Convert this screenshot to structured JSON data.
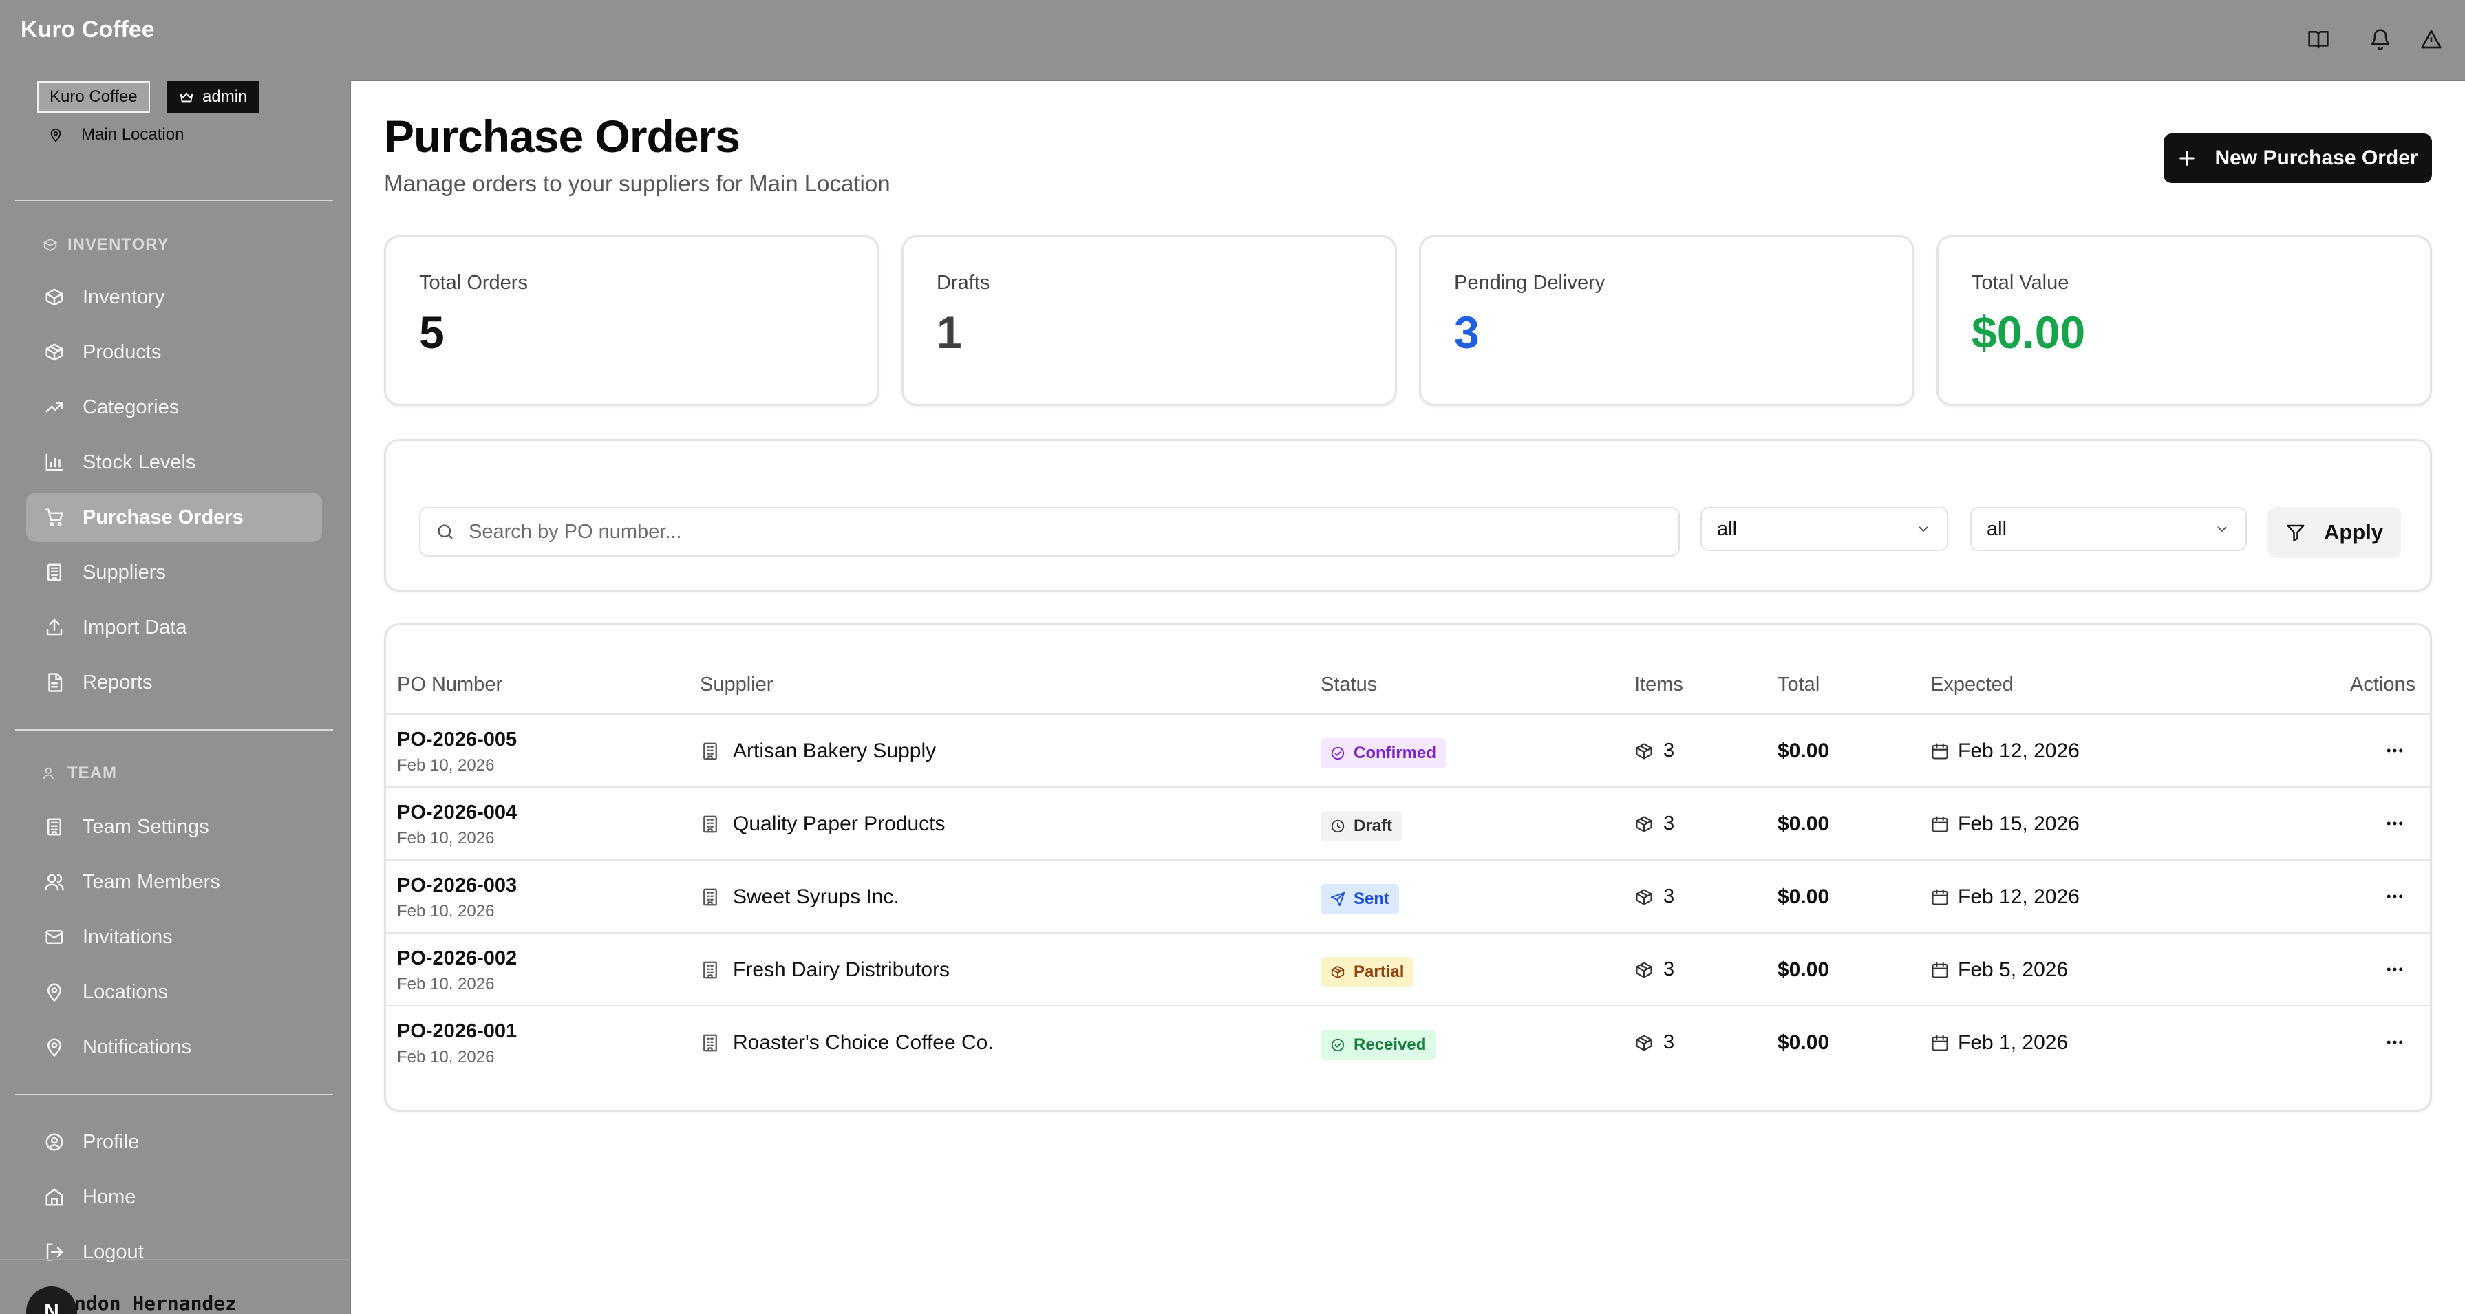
{
  "app": {
    "name": "Kuro Coffee"
  },
  "sidebar": {
    "org_badge": "Kuro Coffee",
    "role_badge": "admin",
    "location": "Main Location",
    "inventory_title": "INVENTORY",
    "inventory_items": [
      {
        "label": "Inventory",
        "icon": "box-icon"
      },
      {
        "label": "Products",
        "icon": "package-icon"
      },
      {
        "label": "Categories",
        "icon": "trending-up-icon"
      },
      {
        "label": "Stock Levels",
        "icon": "bar-chart-icon"
      },
      {
        "label": "Purchase Orders",
        "icon": "cart-icon",
        "active": true
      },
      {
        "label": "Suppliers",
        "icon": "building-icon"
      },
      {
        "label": "Import Data",
        "icon": "upload-icon"
      },
      {
        "label": "Reports",
        "icon": "file-icon"
      }
    ],
    "team_title": "TEAM",
    "team_items": [
      {
        "label": "Team Settings",
        "icon": "building-icon"
      },
      {
        "label": "Team Members",
        "icon": "users-icon"
      },
      {
        "label": "Invitations",
        "icon": "mail-icon"
      },
      {
        "label": "Locations",
        "icon": "map-pin-icon"
      },
      {
        "label": "Notifications",
        "icon": "map-pin-icon"
      }
    ],
    "account_items": [
      {
        "label": "Profile",
        "icon": "user-circle-icon"
      },
      {
        "label": "Home",
        "icon": "home-icon"
      },
      {
        "label": "Logout",
        "icon": "logout-icon"
      }
    ],
    "user": {
      "avatar_initial": "N",
      "name": "ndon Hernandez"
    }
  },
  "topbar": {
    "icons": [
      "book-icon",
      "bell-icon",
      "alert-triangle-icon"
    ]
  },
  "header": {
    "title": "Purchase Orders",
    "subtitle": "Manage orders to your suppliers for Main Location",
    "new_button": "New Purchase Order"
  },
  "stats": [
    {
      "label": "Total Orders",
      "value": "5",
      "color": "#111111"
    },
    {
      "label": "Drafts",
      "value": "1",
      "color": "#3f3f3f"
    },
    {
      "label": "Pending Delivery",
      "value": "3",
      "color": "#1f5fe0"
    },
    {
      "label": "Total Value",
      "value": "$0.00",
      "color": "#16a34a"
    }
  ],
  "filters": {
    "search_placeholder": "Search by PO number...",
    "status_select": "all",
    "supplier_select": "all",
    "apply_label": "Apply"
  },
  "table": {
    "columns": [
      "PO Number",
      "Supplier",
      "Status",
      "Items",
      "Total",
      "Expected",
      "Actions"
    ],
    "rows": [
      {
        "po": "PO-2026-005",
        "date": "Feb 10, 2026",
        "supplier": "Artisan Bakery Supply",
        "status": "Confirmed",
        "status_icon": "check-circle-icon",
        "status_bg": "#f3e8ff",
        "status_fg": "#7e22ce",
        "items": "3",
        "total": "$0.00",
        "expected": "Feb 12, 2026"
      },
      {
        "po": "PO-2026-004",
        "date": "Feb 10, 2026",
        "supplier": "Quality Paper Products",
        "status": "Draft",
        "status_icon": "clock-icon",
        "status_bg": "#f2f2f2",
        "status_fg": "#333333",
        "items": "3",
        "total": "$0.00",
        "expected": "Feb 15, 2026"
      },
      {
        "po": "PO-2026-003",
        "date": "Feb 10, 2026",
        "supplier": "Sweet Syrups Inc.",
        "status": "Sent",
        "status_icon": "send-icon",
        "status_bg": "#dbeafe",
        "status_fg": "#1d4ed8",
        "items": "3",
        "total": "$0.00",
        "expected": "Feb 12, 2026"
      },
      {
        "po": "PO-2026-002",
        "date": "Feb 10, 2026",
        "supplier": "Fresh Dairy Distributors",
        "status": "Partial",
        "status_icon": "package-icon",
        "status_bg": "#fef3c7",
        "status_fg": "#92400e",
        "items": "3",
        "total": "$0.00",
        "expected": "Feb 5, 2026"
      },
      {
        "po": "PO-2026-001",
        "date": "Feb 10, 2026",
        "supplier": "Roaster's Choice Coffee Co.",
        "status": "Received",
        "status_icon": "check-circle-icon",
        "status_bg": "#dcfce7",
        "status_fg": "#15803d",
        "items": "3",
        "total": "$0.00",
        "expected": "Feb 1, 2026"
      }
    ]
  }
}
